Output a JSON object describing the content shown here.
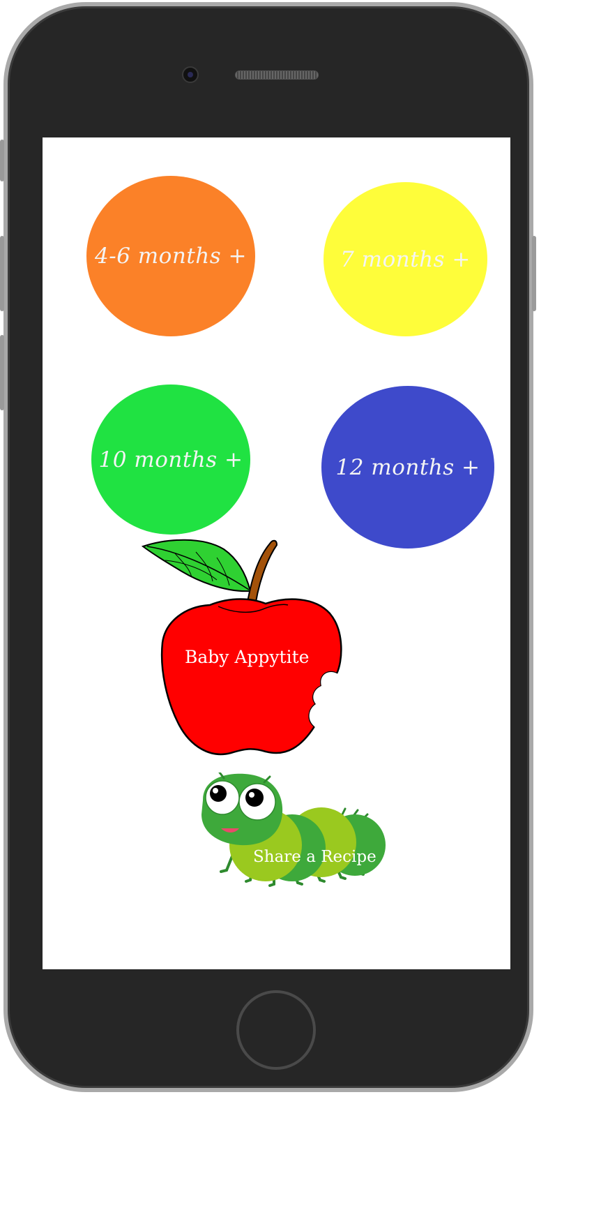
{
  "device": {
    "frame_color": "#262626",
    "bezel_color": "#a9a9a9"
  },
  "menu": {
    "age_buttons": [
      {
        "label": "4-6 months +",
        "color": "#fb8128"
      },
      {
        "label": "7 months +",
        "color": "#fefd3a"
      },
      {
        "label": "10 months +",
        "color": "#20e242"
      },
      {
        "label": "12 months +",
        "color": "#3e4acb"
      }
    ]
  },
  "logo": {
    "label": "Baby Appytite",
    "icon": "apple-icon",
    "color": "#ff0000"
  },
  "share": {
    "label": "Share a Recipe",
    "icon": "caterpillar-icon",
    "color": "#8cc63f"
  }
}
